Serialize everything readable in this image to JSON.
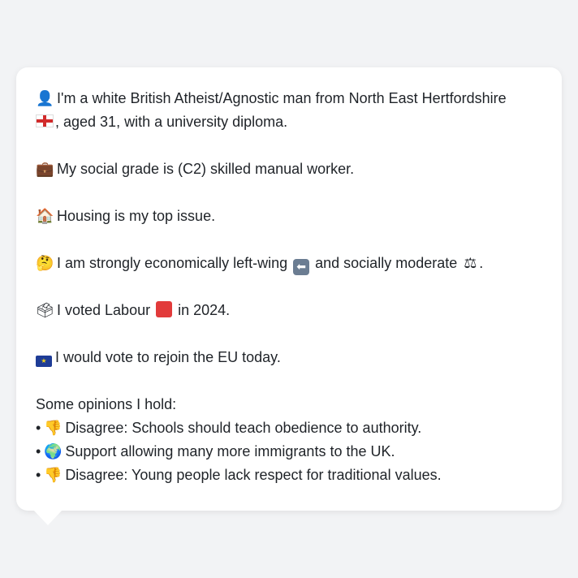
{
  "profile": {
    "intro_line1": "I'm a white British Atheist/Agnostic man from North East Hertfordshire",
    "intro_line2": ", aged 31, with a university diploma.",
    "social_grade": "My social grade is (C2) skilled manual worker.",
    "top_issue": "Housing is my top issue.",
    "ideology_part1": "I am strongly economically left-wing",
    "ideology_part2": "and socially moderate",
    "ideology_end": ".",
    "vote_part1": "I voted Labour",
    "vote_part2": "in 2024.",
    "eu_stance": "I would vote to rejoin the EU today."
  },
  "opinions": {
    "heading": "Some opinions I hold:",
    "items": [
      {
        "icon": "thumbs-down-icon",
        "glyph": "👎",
        "text": "Disagree: Schools should teach obedience to authority."
      },
      {
        "icon": "globe-icon",
        "glyph": "🌍",
        "text": "Support allowing many more immigrants to the UK."
      },
      {
        "icon": "thumbs-down-icon",
        "glyph": "👎",
        "text": "Disagree: Young people lack respect for traditional values."
      }
    ]
  },
  "icons": {
    "person": "👤",
    "briefcase": "💼",
    "house": "🏠",
    "thinking": "🤔",
    "ballot": "🗳",
    "scales": "⚖",
    "arrow_left": "⬅",
    "eu_stars": "★"
  },
  "colors": {
    "background": "#f2f3f5",
    "bubble": "#ffffff",
    "labour_red": "#e23b3b",
    "eu_blue": "#1e3c96"
  }
}
